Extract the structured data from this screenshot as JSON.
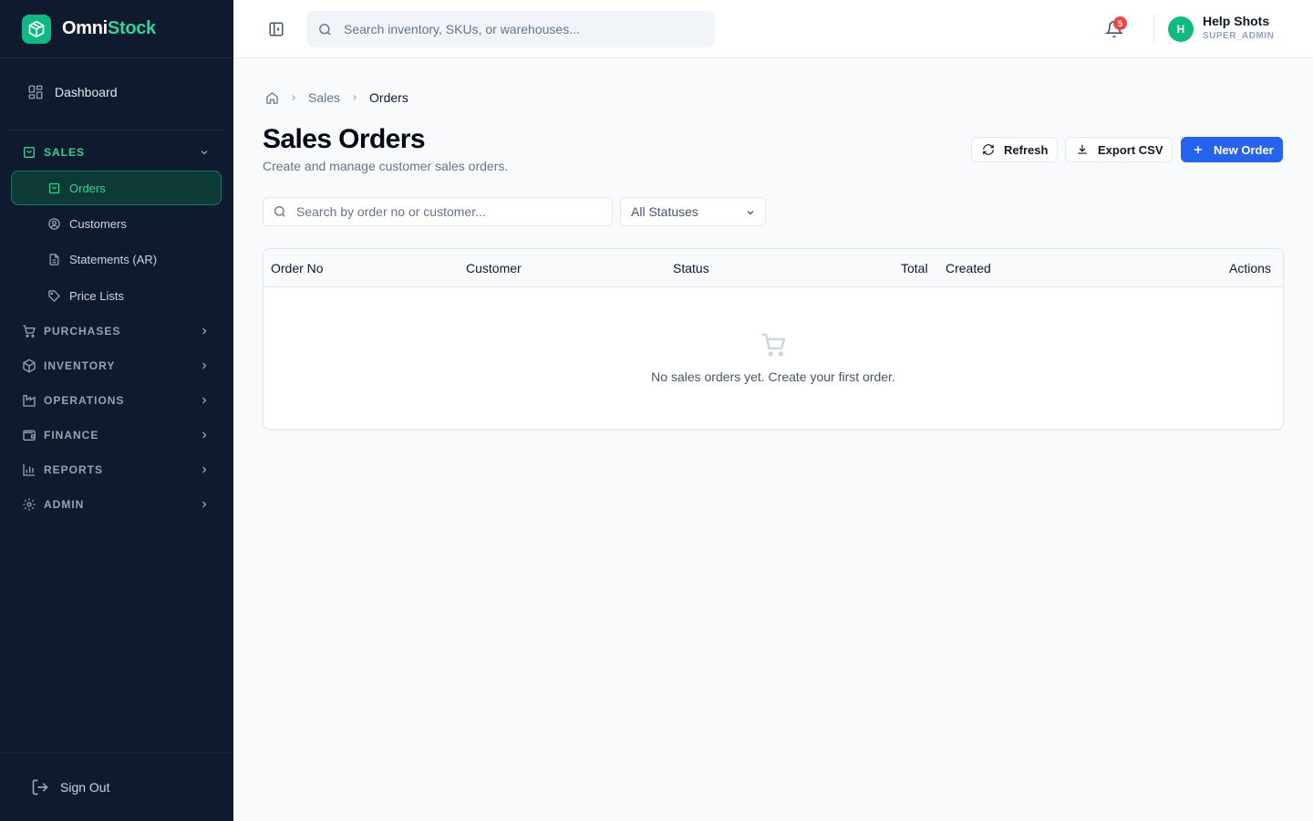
{
  "brand": {
    "part1": "Omni",
    "part2": "Stock"
  },
  "sidebar": {
    "dashboard": "Dashboard",
    "groups": {
      "sales": "SALES",
      "purchases": "PURCHASES",
      "inventory": "INVENTORY",
      "operations": "OPERATIONS",
      "finance": "FINANCE",
      "reports": "REPORTS",
      "admin": "ADMIN"
    },
    "sales_items": [
      "Orders",
      "Customers",
      "Statements (AR)",
      "Price Lists"
    ],
    "active_item": "Orders",
    "sign_out": "Sign Out"
  },
  "header": {
    "search_placeholder": "Search inventory, SKUs, or warehouses...",
    "notification_count": "5",
    "user": {
      "initial": "H",
      "name": "Help Shots",
      "role": "SUPER_ADMIN"
    }
  },
  "breadcrumb": {
    "parent": "Sales",
    "current": "Orders"
  },
  "page": {
    "title": "Sales Orders",
    "subtitle": "Create and manage customer sales orders."
  },
  "actions": {
    "refresh": "Refresh",
    "export": "Export CSV",
    "new_order": "New Order"
  },
  "filters": {
    "search_placeholder": "Search by order no or customer...",
    "status_selected": "All Statuses"
  },
  "table": {
    "columns": [
      "Order No",
      "Customer",
      "Status",
      "Total",
      "Created",
      "Actions"
    ],
    "rows": [],
    "empty_message": "No sales orders yet. Create your first order."
  },
  "colors": {
    "sidebar_bg": "#101a2e",
    "accent": "#10b981",
    "primary": "#2563eb",
    "badge": "#ef4444"
  }
}
